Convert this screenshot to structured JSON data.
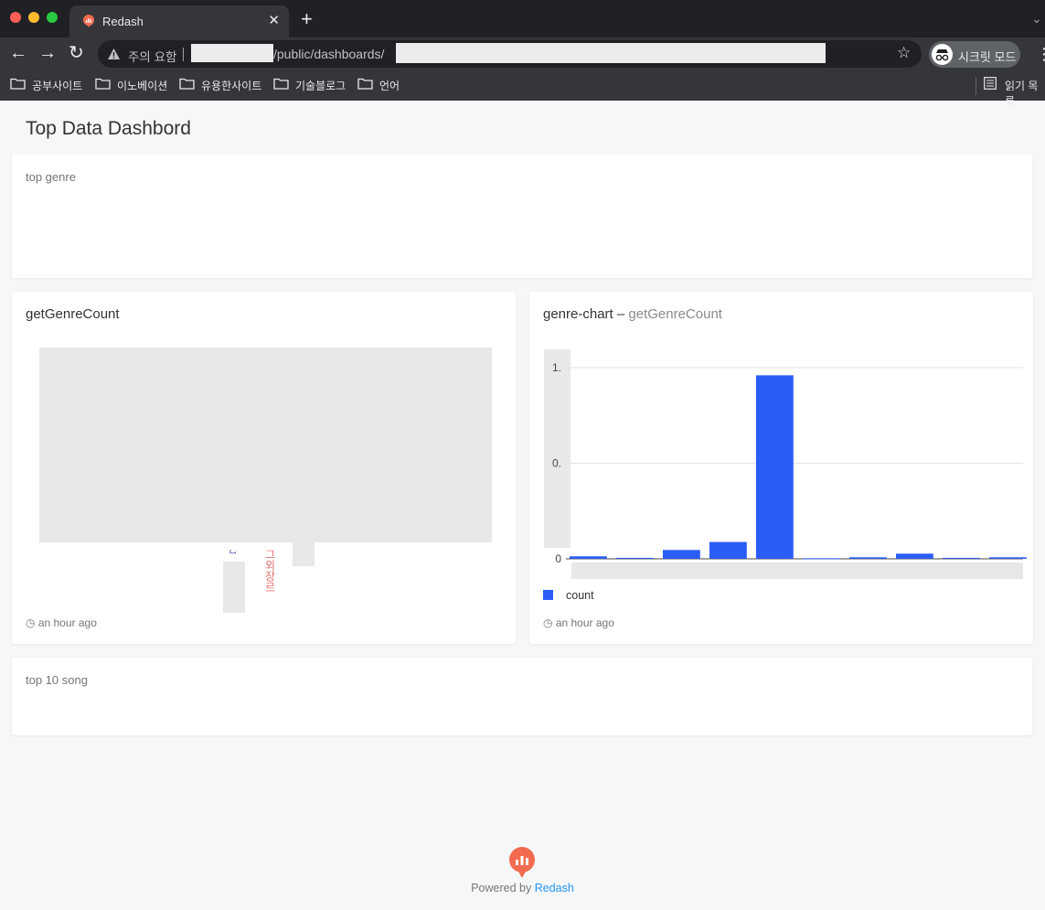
{
  "browser": {
    "tab_title": "Redash",
    "tab_close": "✕",
    "new_tab": "+",
    "tab_menu": "⌄",
    "nav": {
      "back": "←",
      "forward": "→",
      "reload": "↻"
    },
    "security_text": "주의 요함",
    "url_path": "/public/dashboards/",
    "star": "☆",
    "incognito_label": "시크릿 모드",
    "menu": "⋮",
    "traffic_lights": [
      "#ff5f57",
      "#febc2e",
      "#28c840"
    ]
  },
  "bookmarks": {
    "items": [
      "공부사이트",
      "이노베이션",
      "유용한사이트",
      "기술블로그",
      "언어"
    ],
    "reading_list": "읽기 목록"
  },
  "dashboard": {
    "title": "Top Data Dashbord",
    "widgets": {
      "top_genre": {
        "caption": "top genre"
      },
      "genre_table": {
        "title": "getGenreCount",
        "updated": "an hour ago",
        "red_label": "그외장르",
        "blue_label": "J"
      },
      "genre_chart": {
        "title": "genre-chart",
        "separator": "–",
        "subtitle": "getGenreCount",
        "updated": "an hour ago"
      },
      "top_songs": {
        "caption": "top 10 song"
      }
    }
  },
  "chart_data": {
    "type": "bar",
    "categories": [],
    "series": [
      {
        "name": "count",
        "values": [
          0.013,
          0.005,
          0.046,
          0.088,
          0.96,
          0.003,
          0.008,
          0.027,
          0.005,
          0.008
        ]
      }
    ],
    "y_tick_labels": [
      "0",
      "0.",
      "1."
    ],
    "ylim": [
      0,
      1
    ],
    "grid": true,
    "legend_placement": "bottom-left",
    "bar_color": "#2a5cf6"
  },
  "footer": {
    "powered_by": "Powered by ",
    "brand": "Redash"
  },
  "colors": {
    "accent": "#2196f3",
    "logo": "#f26b4f"
  }
}
